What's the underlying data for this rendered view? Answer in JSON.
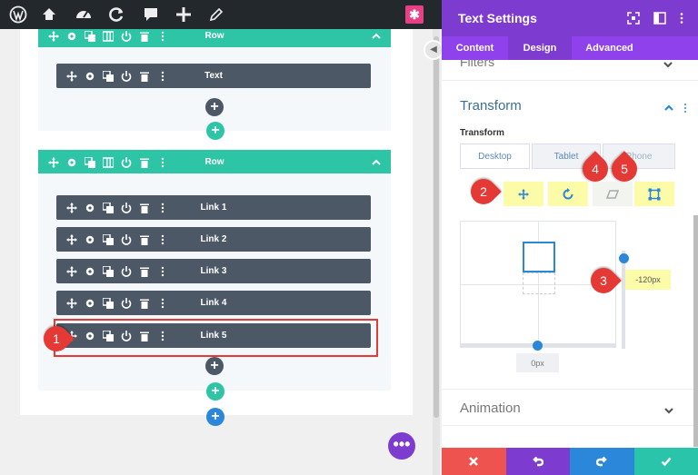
{
  "topbar": {
    "icons": [
      "wordpress-icon",
      "sitemap-icon",
      "dashboard-icon",
      "refresh-icon",
      "comment-icon",
      "plus-icon",
      "edit-icon"
    ],
    "divi_logo": "✱"
  },
  "canvas": {
    "row1": {
      "title": "Row",
      "modules": [
        "Text"
      ]
    },
    "row2": {
      "title": "Row",
      "modules": [
        "Link 1",
        "Link 2",
        "Link 3",
        "Link 4",
        "Link 5"
      ]
    },
    "fab_label": "•••"
  },
  "panel": {
    "title": "Text Settings",
    "tabs": [
      "Content",
      "Design",
      "Advanced"
    ],
    "active_tab": "Design",
    "prev_section": "Filters",
    "section": "Transform",
    "transform_label": "Transform",
    "device_tabs": [
      "Desktop",
      "Tablet",
      "Phone"
    ],
    "active_device": "Desktop",
    "vertical_value": "-120px",
    "horizontal_value": "0px",
    "next_section": "Animation"
  },
  "markers": [
    "1",
    "2",
    "3",
    "4",
    "5"
  ],
  "colors": {
    "purple": "#7e3bd0",
    "teal": "#2ec4a6",
    "module": "#4c5866",
    "accent_blue": "#2b87da",
    "discard": "#ef5350",
    "undo": "#7e3bd0",
    "redo": "#2b87da",
    "save": "#29c4a9",
    "marker_red": "#e53935"
  }
}
